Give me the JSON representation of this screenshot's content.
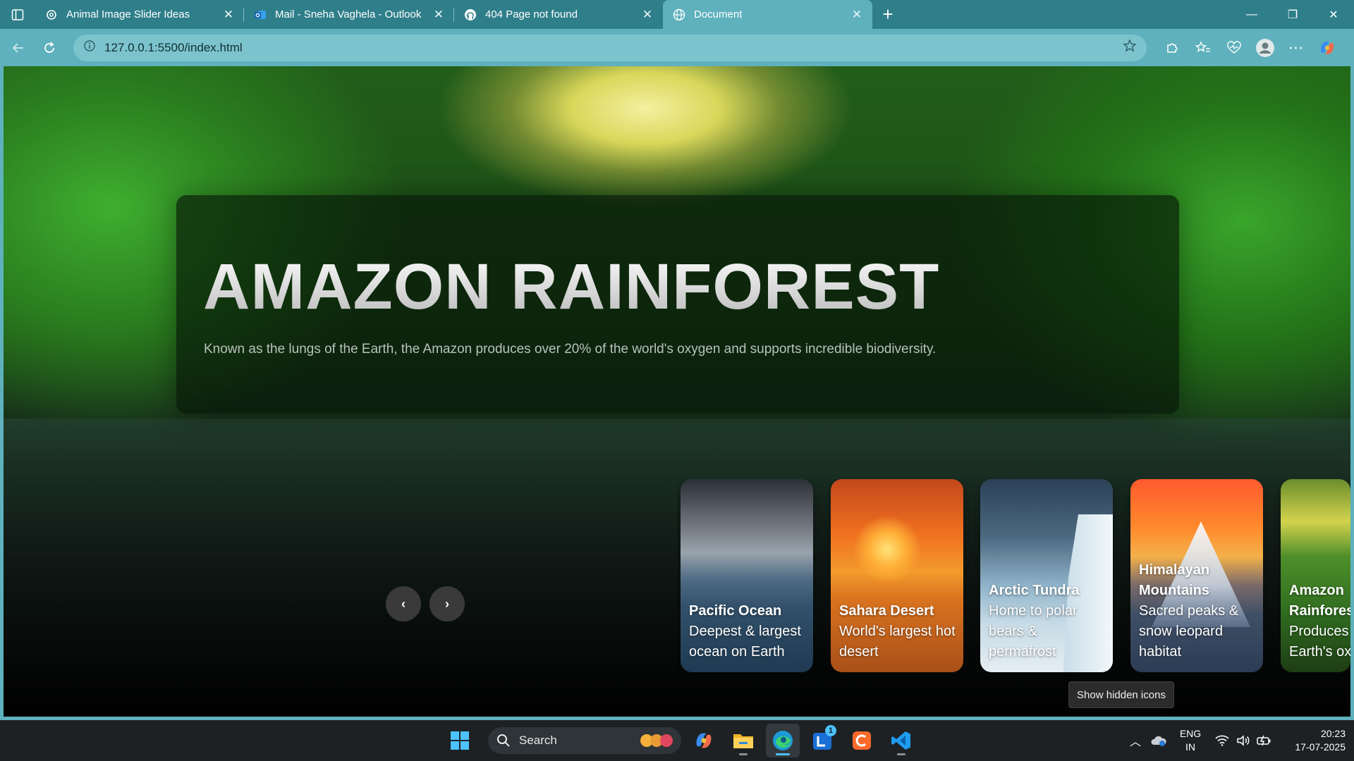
{
  "browser": {
    "tabs": [
      {
        "title": "Animal Image Slider Ideas",
        "icon": "chatgpt-icon"
      },
      {
        "title": "Mail - Sneha Vaghela - Outlook",
        "icon": "outlook-icon"
      },
      {
        "title": "404 Page not found",
        "icon": "github-icon"
      },
      {
        "title": "Document",
        "icon": "globe-icon",
        "active": true
      }
    ],
    "address": "127.0.0.1:5500/index.html"
  },
  "hero": {
    "title": "AMAZON RAINFOREST",
    "description": "Known as the lungs of the Earth, the Amazon produces over 20% of the world's oxygen and supports incredible biodiversity."
  },
  "nav": {
    "prev": "‹",
    "next": "›"
  },
  "cards": [
    {
      "name": "Pacific Ocean",
      "desc": "Deepest & largest ocean on Earth"
    },
    {
      "name": "Sahara Desert",
      "desc": "World's largest hot desert"
    },
    {
      "name": "Arctic Tundra",
      "desc": "Home to polar bears & permafrost"
    },
    {
      "name": "Himalayan Mountains",
      "desc": "Sacred peaks & snow leopard habitat"
    },
    {
      "name": "Amazon Rainforest",
      "desc": "Produces Earth's oxy"
    }
  ],
  "tooltip": "Show hidden icons",
  "taskbar": {
    "search_label": "Search",
    "lang_top": "ENG",
    "lang_bottom": "IN",
    "time": "20:23",
    "date": "17-07-2025",
    "badge": "1"
  },
  "colors": {
    "chrome": "#2f7f8a",
    "toolbar": "#5eb1bd",
    "taskbar": "#1d2124"
  }
}
